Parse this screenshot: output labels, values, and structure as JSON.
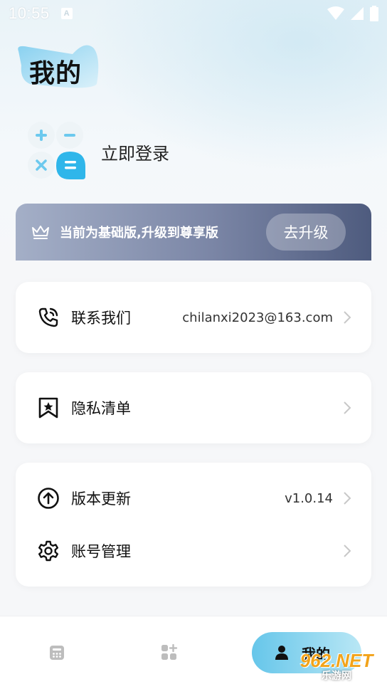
{
  "status_bar": {
    "time": "10:55",
    "notif_badge": "A"
  },
  "header": {
    "title": "我的"
  },
  "login": {
    "label": "立即登录"
  },
  "premium": {
    "text": "当前为基础版,升级到尊享版",
    "button": "去升级"
  },
  "contact_card": {
    "label": "联系我们",
    "value": "chilanxi2023@163.com"
  },
  "privacy_card": {
    "label": "隐私清单"
  },
  "settings_card": {
    "items": [
      {
        "label": "版本更新",
        "value": "v1.0.14"
      },
      {
        "label": "账号管理",
        "value": ""
      }
    ]
  },
  "bottom_nav": {
    "items": [
      {
        "icon": "calculator-icon",
        "label": ""
      },
      {
        "icon": "apps-icon",
        "label": ""
      },
      {
        "icon": "person-icon",
        "label": "我的"
      }
    ]
  },
  "watermark": {
    "top": "962.NET",
    "bottom": "乐游网"
  },
  "colors": {
    "accent": "#2fb6ea",
    "premium_dark": "#4e5b7e",
    "premium_light": "#a4afc7"
  }
}
